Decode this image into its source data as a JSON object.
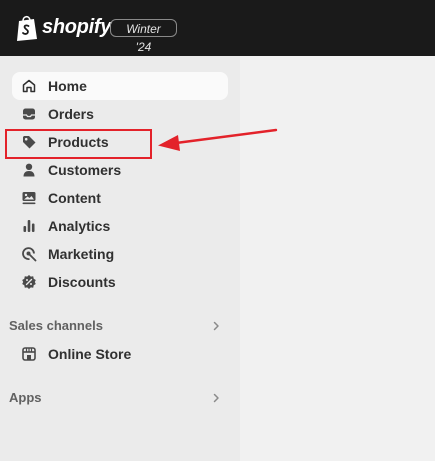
{
  "topbar": {
    "logo_icon": "shopify-bag-icon",
    "brand": "shopify",
    "edition": "Winter '24"
  },
  "sidebar": {
    "items": [
      {
        "label": "Home",
        "icon": "home-icon",
        "active": true
      },
      {
        "label": "Orders",
        "icon": "inbox-icon",
        "active": false
      },
      {
        "label": "Products",
        "icon": "tag-icon",
        "active": false
      },
      {
        "label": "Customers",
        "icon": "person-icon",
        "active": false
      },
      {
        "label": "Content",
        "icon": "image-icon",
        "active": false
      },
      {
        "label": "Analytics",
        "icon": "bar-chart-icon",
        "active": false
      },
      {
        "label": "Marketing",
        "icon": "target-icon",
        "active": false
      },
      {
        "label": "Discounts",
        "icon": "discount-badge-icon",
        "active": false
      }
    ],
    "sales_channels": {
      "label": "Sales channels",
      "items": [
        {
          "label": "Online Store",
          "icon": "store-icon"
        }
      ]
    },
    "apps": {
      "label": "Apps"
    }
  },
  "annotation": {
    "color": "#e3222a",
    "target": "Products"
  },
  "colors": {
    "topbar": "#1a1a1a",
    "sidebar": "#ebebeb",
    "main": "#f1f1f1",
    "active_item": "#fafafa",
    "text": "#303030"
  }
}
